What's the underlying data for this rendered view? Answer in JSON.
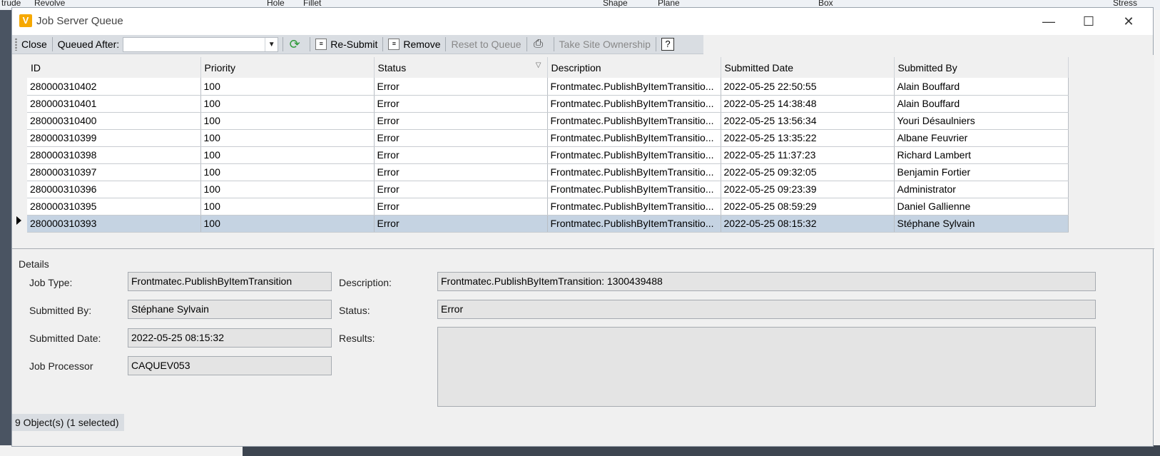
{
  "background": {
    "fragments": [
      "trude",
      "Revolve",
      "Hole",
      "Fillet",
      "Shape",
      "Plane",
      "Box",
      "Stress"
    ]
  },
  "window": {
    "title": "Job Server Queue",
    "icon_letter": "V",
    "controls": {
      "minimize": "—",
      "maximize": "☐",
      "close": "✕"
    }
  },
  "toolbar": {
    "close_label": "Close",
    "queued_after_label": "Queued After:",
    "queued_after_value": "",
    "resubmit_label": "Re-Submit",
    "remove_label": "Remove",
    "reset_label": "Reset to Queue",
    "take_ownership_label": "Take Site Ownership",
    "help_label": "?"
  },
  "grid": {
    "columns": [
      "ID",
      "Priority",
      "Status",
      "Description",
      "Submitted Date",
      "Submitted By"
    ],
    "rows": [
      [
        "280000310402",
        "100",
        "Error",
        "Frontmatec.PublishByItemTransitio...",
        "2022-05-25 22:50:55",
        "Alain Bouffard"
      ],
      [
        "280000310401",
        "100",
        "Error",
        "Frontmatec.PublishByItemTransitio...",
        "2022-05-25 14:38:48",
        "Alain Bouffard"
      ],
      [
        "280000310400",
        "100",
        "Error",
        "Frontmatec.PublishByItemTransitio...",
        "2022-05-25 13:56:34",
        "Youri Désaulniers"
      ],
      [
        "280000310399",
        "100",
        "Error",
        "Frontmatec.PublishByItemTransitio...",
        "2022-05-25 13:35:22",
        "Albane Feuvrier"
      ],
      [
        "280000310398",
        "100",
        "Error",
        "Frontmatec.PublishByItemTransitio...",
        "2022-05-25 11:37:23",
        "Richard Lambert"
      ],
      [
        "280000310397",
        "100",
        "Error",
        "Frontmatec.PublishByItemTransitio...",
        "2022-05-25 09:32:05",
        "Benjamin Fortier"
      ],
      [
        "280000310396",
        "100",
        "Error",
        "Frontmatec.PublishByItemTransitio...",
        "2022-05-25 09:23:39",
        "Administrator"
      ],
      [
        "280000310395",
        "100",
        "Error",
        "Frontmatec.PublishByItemTransitio...",
        "2022-05-25 08:59:29",
        "Daniel Gallienne"
      ],
      [
        "280000310393",
        "100",
        "Error",
        "Frontmatec.PublishByItemTransitio...",
        "2022-05-25 08:15:32",
        "Stéphane Sylvain"
      ]
    ],
    "selected_index": 8
  },
  "details": {
    "section_label": "Details",
    "job_type_label": "Job Type:",
    "job_type": "Frontmatec.PublishByItemTransition",
    "submitted_by_label": "Submitted By:",
    "submitted_by": "Stéphane Sylvain",
    "submitted_date_label": "Submitted Date:",
    "submitted_date": "2022-05-25 08:15:32",
    "job_processor_label": "Job Processor",
    "job_processor": "CAQUEV053",
    "description_label": "Description:",
    "description": "Frontmatec.PublishByItemTransition: 1300439488",
    "status_label": "Status:",
    "status": "Error",
    "results_label": "Results:",
    "results": ""
  },
  "statusbar": {
    "text": "9 Object(s) (1 selected)"
  },
  "colors": {
    "selected_row": "#c5d3e2",
    "toolbar": "#d9dde2",
    "app_icon": "#f6a800"
  }
}
